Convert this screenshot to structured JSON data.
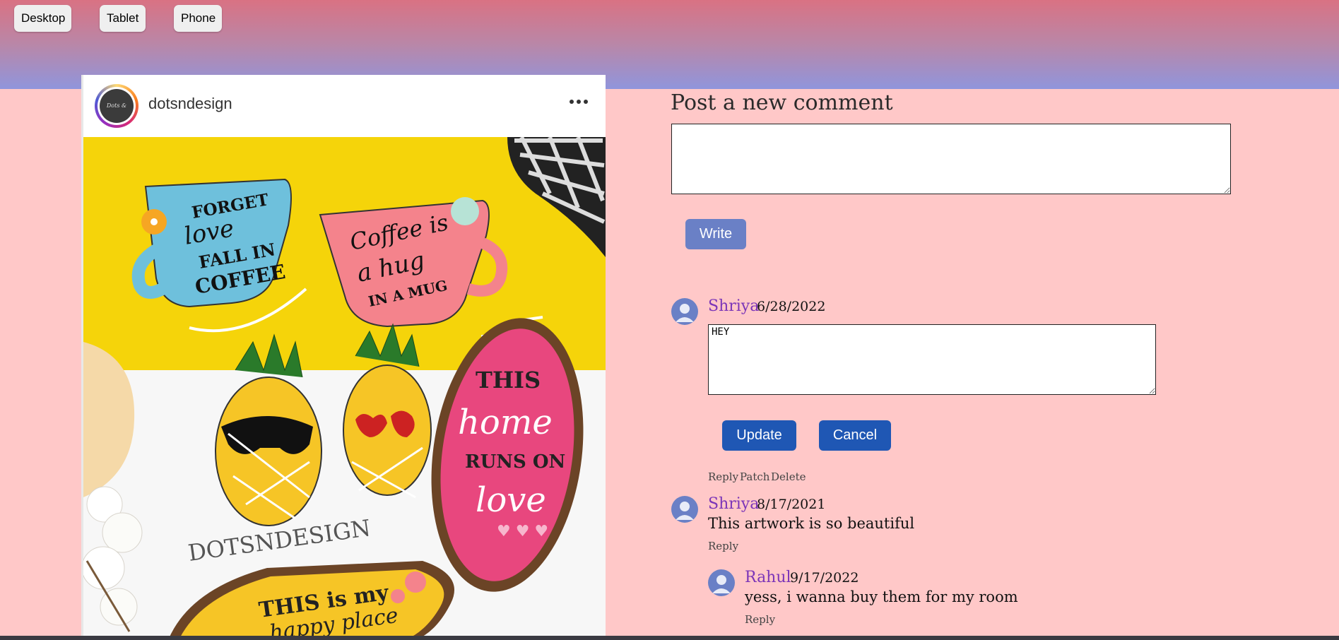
{
  "toolbar": {
    "desktop": "Desktop",
    "tablet": "Tablet",
    "phone": "Phone"
  },
  "post": {
    "username": "dotsndesign",
    "avatar_text": "Dots & Design",
    "image_texts": {
      "cup1": [
        "FORGET",
        "love",
        "FALL IN",
        "COFFEE"
      ],
      "cup2": [
        "Coffee is",
        "a hug",
        "IN A MUG"
      ],
      "oval": [
        "THIS",
        "home",
        "RUNS ON",
        "love"
      ],
      "brand": "DOTSNDESIGN",
      "bottom": [
        "THIS is my",
        "happy place"
      ]
    }
  },
  "compose": {
    "title": "Post a new comment",
    "value": "",
    "write_label": "Write"
  },
  "comments": [
    {
      "name": "Shriya",
      "date": "6/28/2022",
      "edit_value": "HEY",
      "update_label": "Update",
      "cancel_label": "Cancel",
      "actions": [
        "Reply",
        "Patch",
        "Delete"
      ]
    },
    {
      "name": "Shriya",
      "date": "8/17/2021",
      "text": "This artwork is so beautiful",
      "reply_label": "Reply"
    },
    {
      "name": "Rahul",
      "date": "9/17/2022",
      "text": "yess, i wanna buy them for my room",
      "reply_label": "Reply"
    }
  ],
  "colors": {
    "page_bg": "#ffc8c8",
    "accent": "#1f57b4",
    "name": "#7b35b8"
  }
}
